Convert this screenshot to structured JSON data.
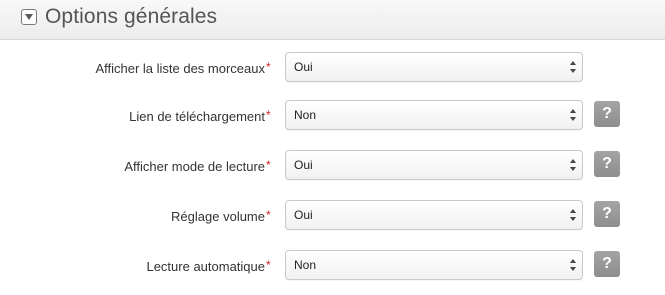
{
  "section": {
    "title": "Options générales"
  },
  "form": {
    "rows": [
      {
        "label": "Afficher la liste des morceaux",
        "required": "*",
        "value": "Oui",
        "help": ""
      },
      {
        "label": "Lien de téléchargement",
        "required": "*",
        "value": "Non",
        "help": "?"
      },
      {
        "label": "Afficher mode de lecture",
        "required": "*",
        "value": "Oui",
        "help": "?"
      },
      {
        "label": "Réglage volume",
        "required": "*",
        "value": "Oui",
        "help": "?"
      },
      {
        "label": "Lecture automatique",
        "required": "*",
        "value": "Non",
        "help": "?"
      }
    ]
  },
  "colors": {
    "required_marker": "#cc2222",
    "help_button": "#999999"
  },
  "icons": {
    "collapse": "triangle-down-icon",
    "select_arrows": "up-down-arrows-icon"
  }
}
